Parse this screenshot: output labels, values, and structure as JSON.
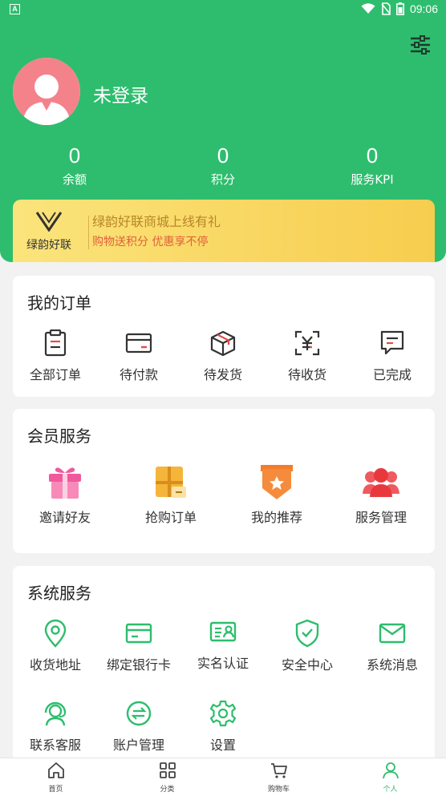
{
  "status_bar": {
    "time": "09:06",
    "notification_icon": "A"
  },
  "profile": {
    "login_status": "未登录"
  },
  "stats": [
    {
      "value": "0",
      "label": "余额"
    },
    {
      "value": "0",
      "label": "积分"
    },
    {
      "value": "0",
      "label": "服务KPI"
    }
  ],
  "banner": {
    "logo_name": "绿韵好联",
    "title": "绿韵好联商城上线有礼",
    "subtitle": "购物送积分 优惠享不停"
  },
  "orders": {
    "title": "我的订单",
    "items": [
      {
        "label": "全部订单",
        "icon": "clipboard-icon"
      },
      {
        "label": "待付款",
        "icon": "card-icon"
      },
      {
        "label": "待发货",
        "icon": "box-icon"
      },
      {
        "label": "待收货",
        "icon": "yen-icon"
      },
      {
        "label": "已完成",
        "icon": "message-icon"
      }
    ]
  },
  "member": {
    "title": "会员服务",
    "items": [
      {
        "label": "邀请好友",
        "icon": "gift-icon"
      },
      {
        "label": "抢购订单",
        "icon": "package-icon"
      },
      {
        "label": "我的推荐",
        "icon": "star-badge-icon"
      },
      {
        "label": "服务管理",
        "icon": "users-icon"
      }
    ]
  },
  "system": {
    "title": "系统服务",
    "items": [
      {
        "label": "收货地址",
        "icon": "location-icon"
      },
      {
        "label": "绑定银行卡",
        "icon": "bank-card-icon"
      },
      {
        "label": "实名认证",
        "icon": "id-card-icon"
      },
      {
        "label": "安全中心",
        "icon": "shield-icon"
      },
      {
        "label": "系统消息",
        "icon": "mail-icon"
      },
      {
        "label": "联系客服",
        "icon": "headset-icon"
      },
      {
        "label": "账户管理",
        "icon": "exchange-icon"
      },
      {
        "label": "设置",
        "icon": "gear-icon"
      }
    ]
  },
  "tabs": [
    {
      "label": "首页",
      "icon": "home-icon"
    },
    {
      "label": "分类",
      "icon": "grid-icon"
    },
    {
      "label": "购物车",
      "icon": "cart-icon"
    },
    {
      "label": "个人",
      "icon": "person-icon"
    }
  ],
  "colors": {
    "brand_green": "#2ebd6e",
    "accent_red": "#e84a4a",
    "banner_yellow": "#f7cd4e"
  }
}
